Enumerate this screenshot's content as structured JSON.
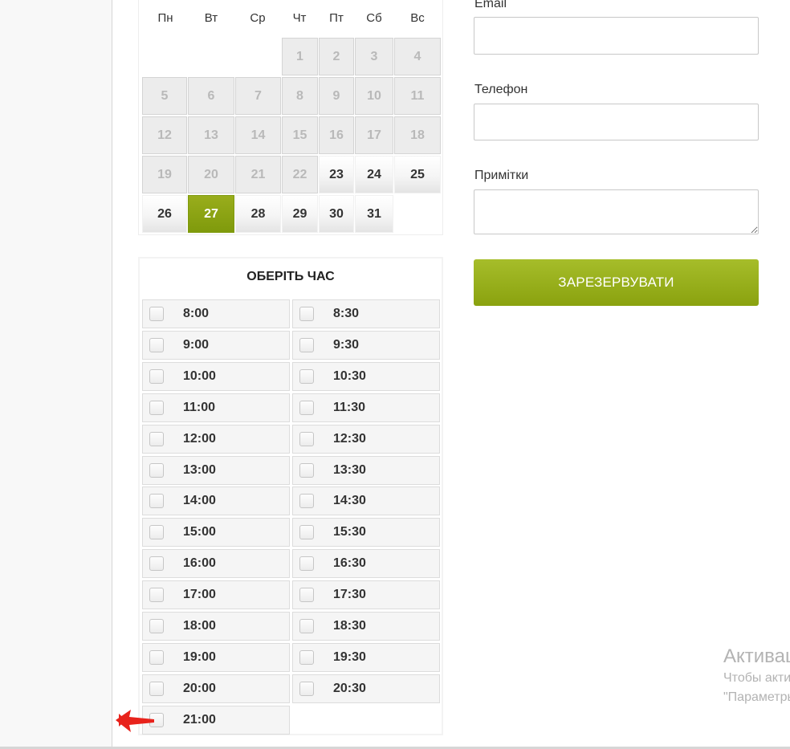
{
  "calendar": {
    "weekdays": [
      "Пн",
      "Вт",
      "Ср",
      "Чт",
      "Пт",
      "Сб",
      "Вс"
    ],
    "weeks": [
      [
        {
          "label": "",
          "state": "empty"
        },
        {
          "label": "",
          "state": "empty"
        },
        {
          "label": "",
          "state": "empty"
        },
        {
          "label": "1",
          "state": "past"
        },
        {
          "label": "2",
          "state": "past"
        },
        {
          "label": "3",
          "state": "past"
        },
        {
          "label": "4",
          "state": "past"
        }
      ],
      [
        {
          "label": "5",
          "state": "past"
        },
        {
          "label": "6",
          "state": "past"
        },
        {
          "label": "7",
          "state": "past"
        },
        {
          "label": "8",
          "state": "past"
        },
        {
          "label": "9",
          "state": "past"
        },
        {
          "label": "10",
          "state": "past"
        },
        {
          "label": "11",
          "state": "past"
        }
      ],
      [
        {
          "label": "12",
          "state": "past"
        },
        {
          "label": "13",
          "state": "past"
        },
        {
          "label": "14",
          "state": "past"
        },
        {
          "label": "15",
          "state": "past"
        },
        {
          "label": "16",
          "state": "past"
        },
        {
          "label": "17",
          "state": "past"
        },
        {
          "label": "18",
          "state": "past"
        }
      ],
      [
        {
          "label": "19",
          "state": "past"
        },
        {
          "label": "20",
          "state": "past"
        },
        {
          "label": "21",
          "state": "past"
        },
        {
          "label": "22",
          "state": "past"
        },
        {
          "label": "23",
          "state": "available"
        },
        {
          "label": "24",
          "state": "available"
        },
        {
          "label": "25",
          "state": "available"
        }
      ],
      [
        {
          "label": "26",
          "state": "available"
        },
        {
          "label": "27",
          "state": "selected"
        },
        {
          "label": "28",
          "state": "available"
        },
        {
          "label": "29",
          "state": "available"
        },
        {
          "label": "30",
          "state": "available"
        },
        {
          "label": "31",
          "state": "available"
        },
        {
          "label": "",
          "state": "empty"
        }
      ]
    ]
  },
  "time_picker": {
    "title": "ОБЕРІТЬ ЧАС",
    "slots": [
      "8:00",
      "8:30",
      "9:00",
      "9:30",
      "10:00",
      "10:30",
      "11:00",
      "11:30",
      "12:00",
      "12:30",
      "13:00",
      "13:30",
      "14:00",
      "14:30",
      "15:00",
      "15:30",
      "16:00",
      "16:30",
      "17:00",
      "17:30",
      "18:00",
      "18:30",
      "19:00",
      "19:30",
      "20:00",
      "20:30",
      "21:00"
    ]
  },
  "form": {
    "email_label": "Email",
    "email_value": "",
    "phone_label": "Телефон",
    "phone_value": "",
    "notes_label": "Примітки",
    "notes_value": "",
    "submit_label": "ЗАРЕЗЕРВУВАТИ"
  },
  "watermark": {
    "title": "Активация Windows",
    "line1": "Чтобы активировать Windows, перейдите",
    "line2": "\"Параметры\"."
  },
  "colors": {
    "accent_green": "#8aa20f",
    "selected_day": "#8ba512",
    "annotation_arrow": "#e8231c"
  }
}
